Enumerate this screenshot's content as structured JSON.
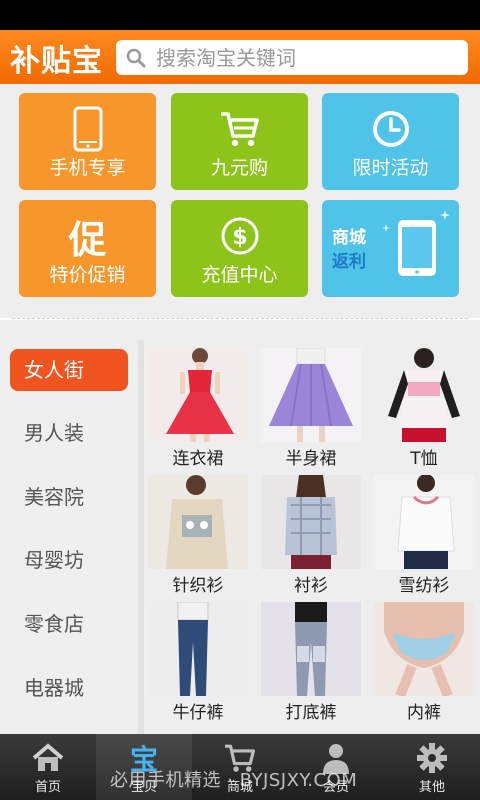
{
  "app": {
    "logo": "补贴宝"
  },
  "search": {
    "placeholder": "搜索淘宝关键词",
    "icon": "search-icon"
  },
  "tiles": [
    {
      "label": "手机专享",
      "icon": "phone-icon",
      "color": "#f7962a"
    },
    {
      "label": "九元购",
      "icon": "cart-icon",
      "color": "#8cc41a"
    },
    {
      "label": "限时活动",
      "icon": "clock-icon",
      "color": "#4fc3e8"
    },
    {
      "label": "特价促销",
      "glyph": "促",
      "icon": "promo-icon",
      "color": "#f7962a"
    },
    {
      "label": "充值中心",
      "icon": "dollar-icon",
      "color": "#8cc41a"
    },
    {
      "line1": "商城",
      "line2": "返利",
      "icon": "tablet-icon",
      "color": "#4fc3e8"
    }
  ],
  "categories": [
    {
      "label": "女人街",
      "active": true
    },
    {
      "label": "男人装"
    },
    {
      "label": "美容院"
    },
    {
      "label": "母婴坊"
    },
    {
      "label": "零食店"
    },
    {
      "label": "电器城"
    }
  ],
  "products": [
    {
      "label": "连衣裙"
    },
    {
      "label": "半身裙"
    },
    {
      "label": "T恤"
    },
    {
      "label": "针织衫"
    },
    {
      "label": "衬衫"
    },
    {
      "label": "雪纺衫"
    },
    {
      "label": "牛仔裤"
    },
    {
      "label": "打底裤"
    },
    {
      "label": "内裤"
    }
  ],
  "bottom_nav": [
    {
      "label": "首页",
      "icon": "home-icon"
    },
    {
      "label": "宝贝",
      "glyph": "宝",
      "icon": "bao-icon",
      "active": true
    },
    {
      "label": "商城",
      "icon": "cart-icon"
    },
    {
      "label": "会员",
      "icon": "user-icon"
    },
    {
      "label": "其他",
      "icon": "gear-icon"
    }
  ],
  "watermark": "必用手机精选 · BYJSJXY.COM",
  "colors": {
    "header": "#f26a00",
    "active_category": "#f0541f"
  }
}
